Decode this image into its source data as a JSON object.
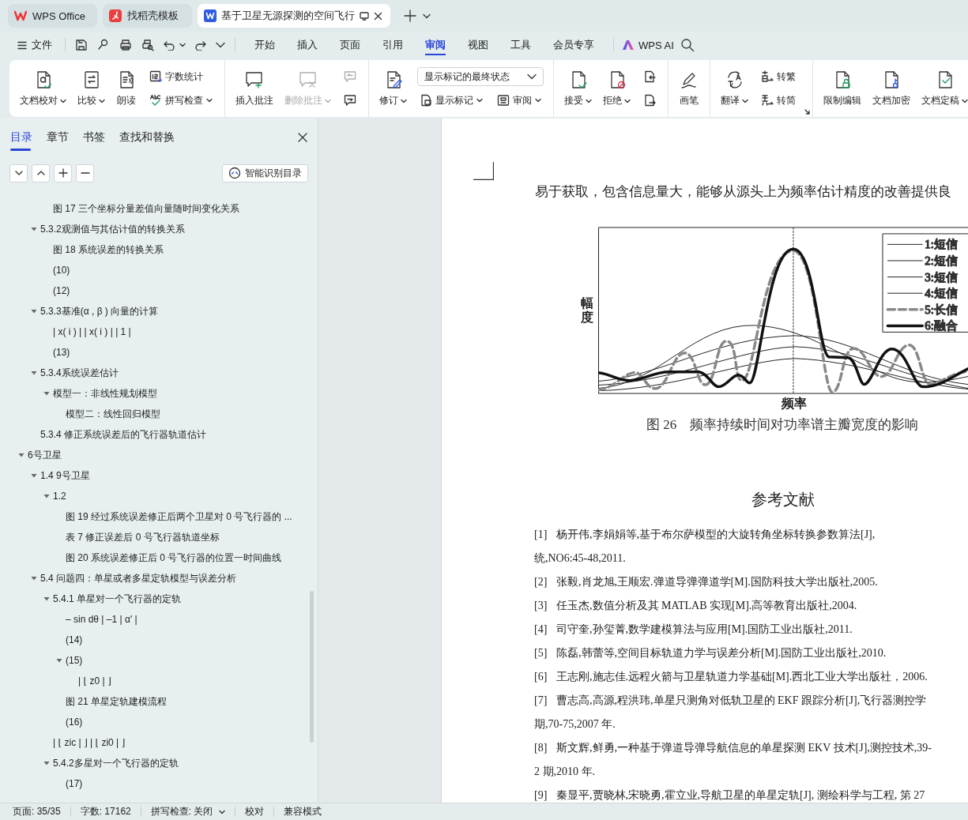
{
  "tabs": [
    {
      "label": "WPS Office",
      "selected": false
    },
    {
      "label": "找稻壳模板",
      "selected": false
    },
    {
      "label": "基于卫星无源探测的空间飞行",
      "selected": true
    }
  ],
  "menu": {
    "file": "文件",
    "tabs": [
      {
        "label": "开始",
        "selected": false
      },
      {
        "label": "插入",
        "selected": false
      },
      {
        "label": "页面",
        "selected": false
      },
      {
        "label": "引用",
        "selected": false
      },
      {
        "label": "审阅",
        "selected": true
      },
      {
        "label": "视图",
        "selected": false
      },
      {
        "label": "工具",
        "selected": false
      },
      {
        "label": "会员专享",
        "selected": false
      }
    ],
    "ai": "WPS AI"
  },
  "ribbon": {
    "groups": [
      {
        "launcher": false,
        "items": [
          {
            "kind": "large",
            "label": "文档校对",
            "menu": true,
            "disabled": false
          },
          {
            "kind": "large",
            "label": "比较",
            "menu": true,
            "disabled": false
          },
          {
            "kind": "large",
            "label": "朗读",
            "menu": false,
            "disabled": false
          },
          {
            "kind": "stack",
            "items": [
              {
                "kind": "small",
                "label": "字数统计",
                "menu": false,
                "disabled": false
              },
              {
                "kind": "small",
                "label": "拼写检查",
                "menu": true,
                "disabled": false
              }
            ]
          }
        ]
      },
      {
        "launcher": false,
        "items": [
          {
            "kind": "large",
            "label": "插入批注",
            "menu": false,
            "disabled": false
          },
          {
            "kind": "large",
            "label": "删除批注",
            "menu": true,
            "disabled": true
          },
          {
            "kind": "stack",
            "items": [
              {
                "kind": "icon",
                "disabled": true
              },
              {
                "kind": "icon",
                "disabled": false
              }
            ]
          }
        ]
      },
      {
        "launcher": false,
        "items": [
          {
            "kind": "large",
            "label": "修订",
            "menu": true,
            "disabled": false
          },
          {
            "kind": "stack",
            "items": [
              {
                "kind": "select",
                "value": "显示标记的最终状态"
              },
              {
                "kind": "row",
                "items": [
                  {
                    "kind": "small",
                    "label": "显示标记",
                    "menu": true,
                    "disabled": false
                  },
                  {
                    "kind": "small",
                    "label": "审阅",
                    "menu": true,
                    "disabled": false
                  }
                ]
              }
            ]
          }
        ]
      },
      {
        "launcher": false,
        "items": [
          {
            "kind": "large",
            "label": "接受",
            "menu": true,
            "disabled": false
          },
          {
            "kind": "large",
            "label": "拒绝",
            "menu": true,
            "disabled": false
          },
          {
            "kind": "stack",
            "items": [
              {
                "kind": "icon",
                "disabled": false
              },
              {
                "kind": "icon",
                "disabled": false
              }
            ]
          }
        ]
      },
      {
        "launcher": false,
        "items": [
          {
            "kind": "large",
            "label": "画笔",
            "menu": false,
            "disabled": false
          }
        ]
      },
      {
        "launcher": true,
        "items": [
          {
            "kind": "large",
            "label": "翻译",
            "menu": true,
            "disabled": false
          },
          {
            "kind": "stack",
            "items": [
              {
                "kind": "small",
                "label": "转繁",
                "menu": false,
                "disabled": false
              },
              {
                "kind": "small",
                "label": "转简",
                "menu": false,
                "disabled": false
              }
            ]
          }
        ]
      },
      {
        "launcher": false,
        "items": [
          {
            "kind": "large",
            "label": "限制编辑",
            "menu": false,
            "disabled": false
          },
          {
            "kind": "large",
            "label": "文档加密",
            "menu": false,
            "disabled": false
          },
          {
            "kind": "large",
            "label": "文档定稿",
            "menu": true,
            "disabled": false
          }
        ]
      }
    ]
  },
  "nav_pane": {
    "tabs": [
      {
        "label": "目录",
        "selected": true
      },
      {
        "label": "章节",
        "selected": false
      },
      {
        "label": "书签",
        "selected": false
      },
      {
        "label": "查找和替换",
        "selected": false
      }
    ],
    "smart_button": "智能识别目录",
    "outline": [
      {
        "children": [
          {
            "children": [
              {
                "label": "图 17  三个坐标分量差值向量随时间变化关系"
              }
            ]
          },
          {
            "label": "5.3.2观测值与其估计值的转换关系",
            "expanded": true,
            "children": [
              {
                "label": "图 18  系统误差的转换关系"
              },
              {
                "label": "(10)"
              },
              {
                "label": "(12)"
              }
            ]
          },
          {
            "label": "5.3.3基准(α , β ) 向量的计算",
            "expanded": true,
            "children": [
              {
                "label": "|   x( i ) |    |   x( i ) |    |  1 |"
              },
              {
                "label": "(13)"
              }
            ]
          },
          {
            "label": "5.3.4系统误差估计",
            "expanded": true,
            "children": [
              {
                "label": "模型一：非线性规划模型",
                "expanded": true,
                "children": [
                  {
                    "label": "模型二：线性回归模型"
                  }
                ]
              }
            ]
          },
          {
            "label": "5.3.4 修正系统误差后的飞行器轨道估计"
          }
        ]
      },
      {
        "label": "6号卫星",
        "expanded": true,
        "children": [
          {
            "label": "1.4 9号卫星",
            "expanded": true,
            "children": [
              {
                "label": "1.2",
                "expanded": true,
                "children": [
                  {
                    "label": "图 19 经过系统误差修正后两个卫星对 0 号飞行器的 ..."
                  },
                  {
                    "label": "表 7 修正误差后 0 号飞行器轨道坐标"
                  },
                  {
                    "label": "图 20  系统误差修正后 0 号飞行器的位置一时间曲线"
                  }
                ]
              }
            ]
          },
          {
            "label": "5.4 问题四：单星或者多星定轨模型与误差分析",
            "expanded": true,
            "children": [
              {
                "label": "5.4.1 单星对一个飞行器的定轨",
                "expanded": true,
                "children": [
                  {
                    "label": "– sin dθ |  –1 |  α' |"
                  },
                  {
                    "label": "(14)"
                  },
                  {
                    "label": "(15)",
                    "expanded": true,
                    "children": [
                      {
                        "label": "| ⌊  z0 | ⌋"
                      }
                    ]
                  },
                  {
                    "label": "图 21  单星定轨建模流程"
                  },
                  {
                    "label": "(16)"
                  }
                ]
              },
              {
                "label": "| ⌊  zic | ⌋   | ⌊  zi0 | ⌋"
              },
              {
                "label": "5.4.2多星对一个飞行器的定轨",
                "expanded": true,
                "children": [
                  {
                    "label": "(17)"
                  }
                ]
              }
            ]
          }
        ]
      }
    ]
  },
  "document": {
    "paragraph": "易于获取，包含信息量大，能够从源头上为频率估计精度的改善提供良",
    "figure": {
      "y_label": "幅度",
      "x_label": "频率",
      "legend": [
        {
          "label": "1:短信",
          "kind": "thin"
        },
        {
          "label": "2:短信",
          "kind": "thin"
        },
        {
          "label": "3:短信",
          "kind": "thin"
        },
        {
          "label": "4:短信",
          "kind": "thin"
        },
        {
          "label": "5:长信",
          "kind": "dashed"
        },
        {
          "label": "6:融合",
          "kind": "thick"
        }
      ],
      "caption": "图 26　频率持续时间对功率谱主瓣宽度的影响"
    },
    "references_title": "参考文献",
    "references": [
      {
        "number": "[1]",
        "lines": [
          "杨开伟,李娟娟等,基于布尔萨模型的大旋转角坐标转换参数算法[J],",
          "统,NO6:45-48,2011."
        ]
      },
      {
        "number": "[2]",
        "lines": [
          "张毅,肖龙旭,王顺宏.弹道导弹弹道学[M].国防科技大学出版社,2005."
        ]
      },
      {
        "number": "[3]",
        "lines": [
          "任玉杰,数值分析及其  MATLAB 实现[M].高等教育出版社,2004."
        ]
      },
      {
        "number": "[4]",
        "lines": [
          "司守奎,孙玺菁,数学建模算法与应用[M].国防工业出版社,2011."
        ]
      },
      {
        "number": "[5]",
        "lines": [
          "陈磊,韩蕾等,空间目标轨道力学与误差分析[M].国防工业出版社,2010."
        ]
      },
      {
        "number": "[6]",
        "lines": [
          "王志刚,施志佳.远程火箭与卫星轨道力学基础[M].西北工业大学出版社，2006."
        ]
      },
      {
        "number": "[7]",
        "lines": [
          "曹志高,高源,程洪玮,单星只测角对低轨卫星的 EKF 跟踪分析[J],飞行器测控学",
          "期,70-75,2007 年."
        ]
      },
      {
        "number": "[8]",
        "lines": [
          "斯文辉,鲜勇,一种基于弹道导弹导航信息的单星探测  EKV 技术[J],测控技术,39-",
          "2 期,2010 年."
        ]
      },
      {
        "number": "[9]",
        "lines": [
          "秦显平,贾晓林,宋晓勇,霍立业,导航卫星的单星定轨[J], 测绘科学与工程, 第 27"
        ]
      }
    ]
  },
  "status_bar": {
    "page": "页面: 35/35",
    "words": "字数: 17162",
    "spell": "拼写检查: 关闭",
    "proofread": "校对",
    "mode": "兼容模式"
  }
}
